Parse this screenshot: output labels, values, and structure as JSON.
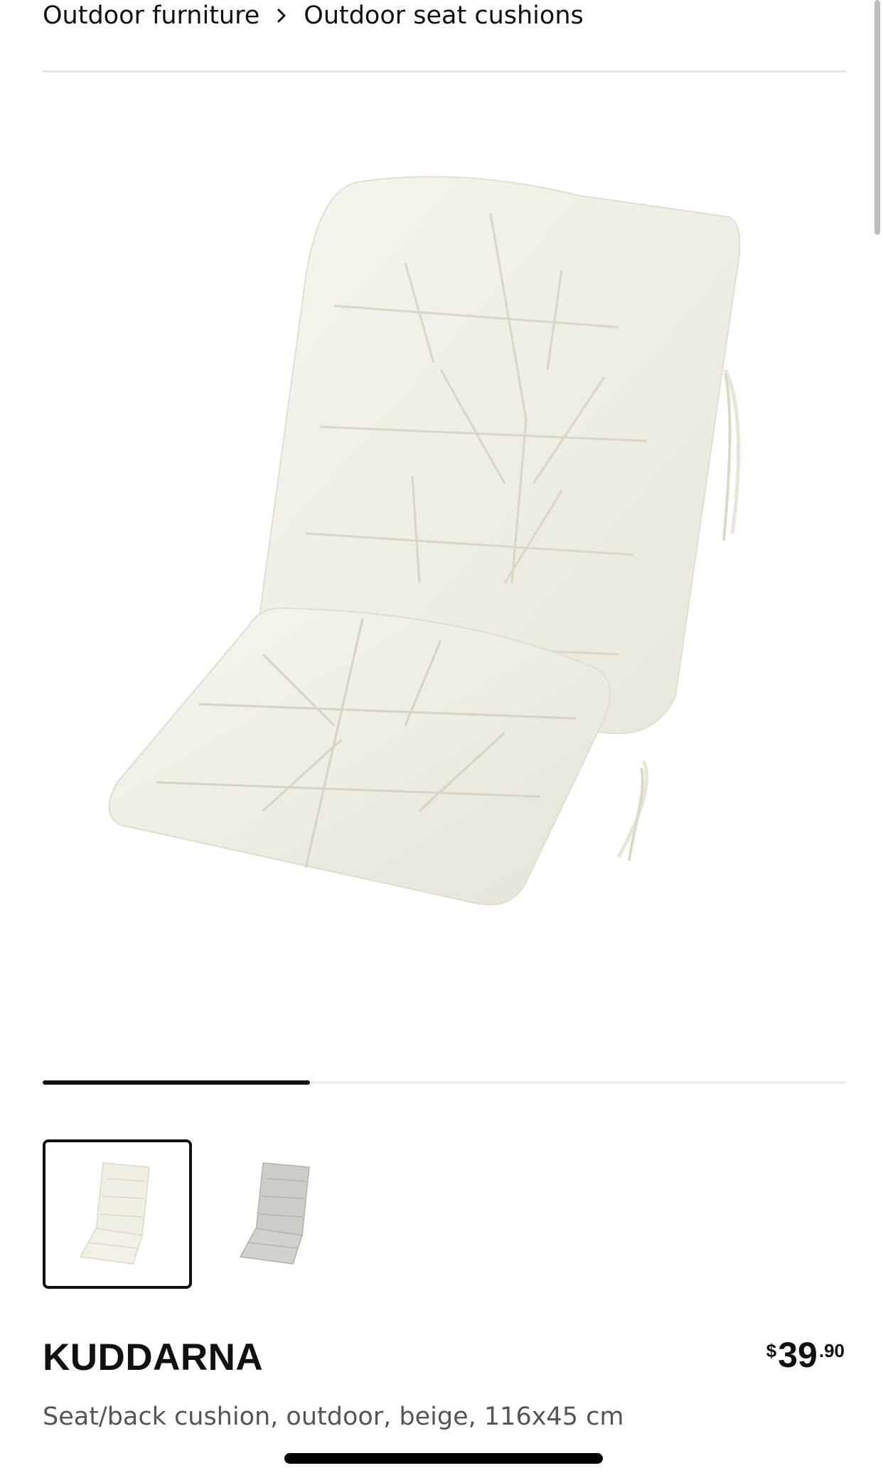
{
  "breadcrumb": {
    "items": [
      "Outdoor furniture",
      "Outdoor seat cushions"
    ]
  },
  "gallery": {
    "progress_fraction": 0.333,
    "thumbnails": [
      {
        "name": "beige-cushion-thumbnail",
        "selected": true
      },
      {
        "name": "grey-cushion-thumbnail",
        "selected": false
      }
    ]
  },
  "product": {
    "name": "KUDDARNA",
    "description": "Seat/back cushion, outdoor, beige, 116x45 cm",
    "price": {
      "currency": "$",
      "whole": "39",
      "decimal": ".90"
    }
  },
  "colors": {
    "cushion_beige": "#f1efe4",
    "cushion_grey": "#c9c8c3",
    "accent": "#111111"
  }
}
